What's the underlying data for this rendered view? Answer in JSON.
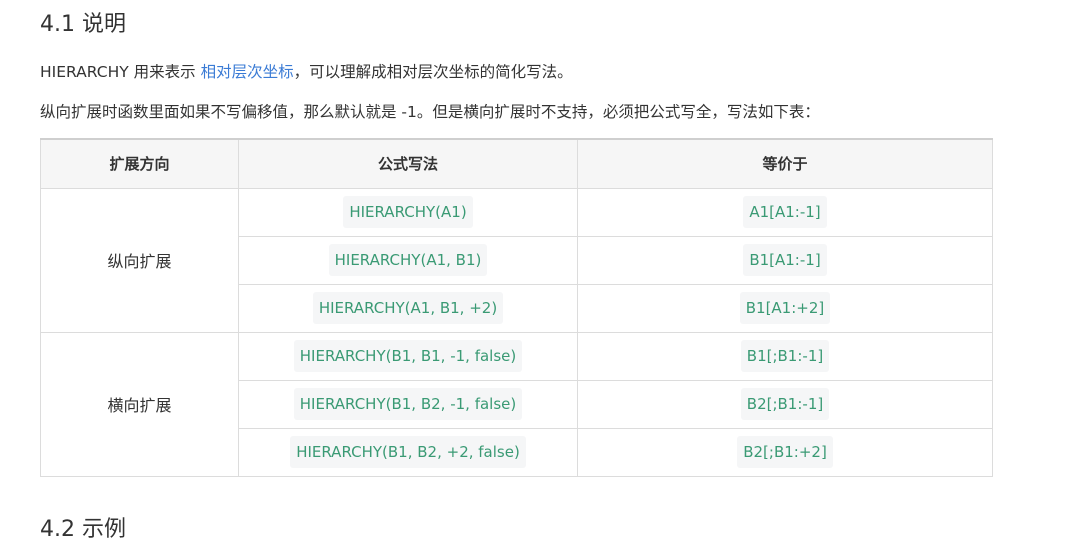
{
  "section1": {
    "title": "4.1 说明",
    "para1": {
      "before": "HIERARCHY 用来表示 ",
      "link": "相对层次坐标",
      "after": "，可以理解成相对层次坐标的简化写法。"
    },
    "para2": "纵向扩展时函数里面如果不写偏移值，那么默认就是 -1。但是横向扩展时不支持，必须把公式写全，写法如下表："
  },
  "table": {
    "headers": [
      "扩展方向",
      "公式写法",
      "等价于"
    ],
    "groups": [
      {
        "direction": "纵向扩展",
        "rows": [
          {
            "formula": "HIERARCHY(A1)",
            "equivalent": "A1[A1:-1]"
          },
          {
            "formula": "HIERARCHY(A1, B1)",
            "equivalent": "B1[A1:-1]"
          },
          {
            "formula": "HIERARCHY(A1, B1, +2)",
            "equivalent": "B1[A1:+2]"
          }
        ]
      },
      {
        "direction": "横向扩展",
        "rows": [
          {
            "formula": "HIERARCHY(B1, B1, -1, false)",
            "equivalent": "B1[;B1:-1]"
          },
          {
            "formula": "HIERARCHY(B1, B2, -1, false)",
            "equivalent": "B2[;B1:-1]"
          },
          {
            "formula": "HIERARCHY(B1, B2, +2, false)",
            "equivalent": "B2[;B1:+2]"
          }
        ]
      }
    ]
  },
  "section2": {
    "title": "4.2 示例"
  },
  "colors": {
    "link": "#3a7bd5",
    "code_text": "#3a9a74",
    "code_bg": "#f5f6f7",
    "header_bg": "#f6f6f6",
    "border": "#dcdcdc"
  }
}
